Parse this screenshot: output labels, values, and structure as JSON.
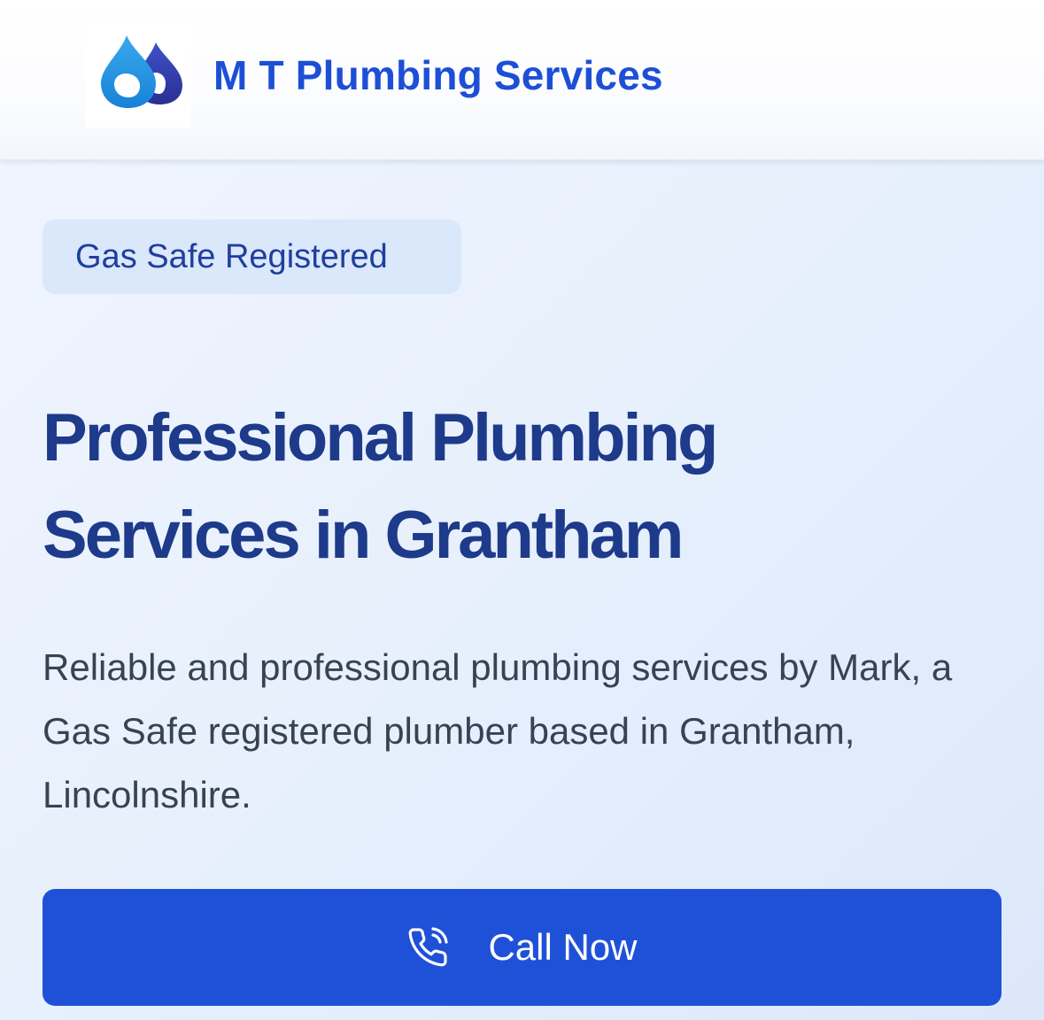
{
  "header": {
    "logo_icon": "water-drops-logo",
    "brand_name": "M T Plumbing Services",
    "brand_color": "#1d4fd6"
  },
  "hero": {
    "badge": "Gas Safe Registered",
    "headline_line1": "Professional Plumbing",
    "headline_line2": "Services in Grantham",
    "description": "Reliable and professional plumbing services by Mark, a Gas Safe registered plumber based in Grantham, Lincolnshire.",
    "cta": {
      "icon": "phone-call-icon",
      "label": "Call Now",
      "color": "#1f51d8"
    }
  }
}
